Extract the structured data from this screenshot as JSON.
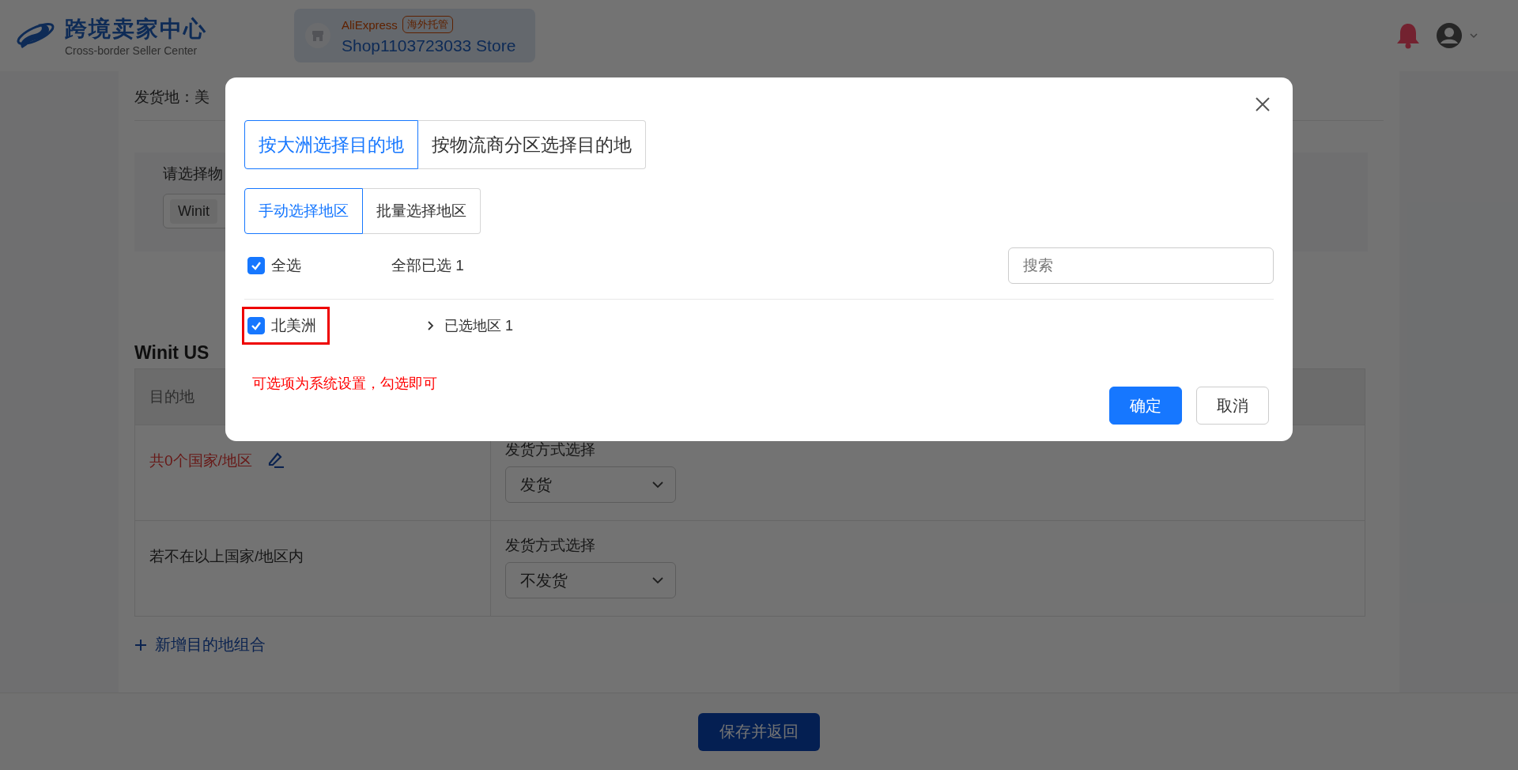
{
  "header": {
    "logo_title": "跨境卖家中心",
    "logo_subtitle": "Cross-border Seller Center",
    "store": {
      "platform": "AliExpress",
      "badge": "海外托管",
      "name": "Shop1103723033 Store"
    }
  },
  "page": {
    "ship_from": "发货地：美",
    "logistics_label": "请选择物",
    "logistics_tag": "Winit",
    "section_title": "Winit US",
    "table": {
      "columns": [
        "目的地"
      ],
      "rows": [
        {
          "kind": "group",
          "destination": "共0个国家/地区",
          "method_label": "发货方式选择",
          "method": "发货"
        },
        {
          "kind": "fallback",
          "destination": "若不在以上国家/地区内",
          "method_label": "发货方式选择",
          "method": "不发货"
        }
      ]
    },
    "add_link": "新增目的地组合"
  },
  "footer": {
    "save_button": "保存并返回"
  },
  "dialog": {
    "tabs": [
      {
        "label": "按大洲选择目的地",
        "selected": true
      },
      {
        "label": "按物流商分区选择目的地",
        "selected": false
      }
    ],
    "mode_tabs": [
      {
        "label": "手动选择地区",
        "selected": true
      },
      {
        "label": "批量选择地区",
        "selected": false
      }
    ],
    "select_all": {
      "label": "全选",
      "checked": true
    },
    "summary": "全部已选 1",
    "search": {
      "placeholder": "搜索"
    },
    "regions": [
      {
        "label": "北美洲",
        "checked": true,
        "highlighted": true,
        "expanded": false,
        "selected_count": "已选地区 1"
      }
    ],
    "note": "可选项为系统设置，勾选即可",
    "buttons": [
      {
        "label": "确定",
        "kind": "primary"
      },
      {
        "label": "取消",
        "kind": "default"
      }
    ]
  }
}
